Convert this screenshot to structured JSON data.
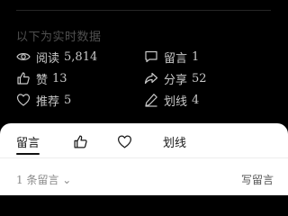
{
  "realtime_label": "以下为实时数据",
  "stats": {
    "reads": {
      "label": "阅读",
      "value": "5,814",
      "icon": "eye-icon"
    },
    "comments": {
      "label": "留言",
      "value": "1",
      "icon": "comment-icon"
    },
    "likes": {
      "label": "赞",
      "value": "13",
      "icon": "thumbs-up-icon"
    },
    "shares": {
      "label": "分享",
      "value": "52",
      "icon": "share-icon"
    },
    "recommends": {
      "label": "推荐",
      "value": "5",
      "icon": "heart-icon"
    },
    "highlights": {
      "label": "划线",
      "value": "4",
      "icon": "pen-icon"
    }
  },
  "sheet": {
    "tabs": {
      "comments": "留言",
      "likes_icon": "thumbs-up-icon",
      "recommend_icon": "heart-icon",
      "highlights": "划线"
    },
    "active_tab": "留言",
    "comment_count": "1 条留言 ⌄",
    "write_comment": "写留言"
  },
  "colors": {
    "background": "#000000",
    "stat_text": "#c8c8c8",
    "muted_text": "#4f4f4f",
    "sheet_bg": "#ffffff"
  }
}
